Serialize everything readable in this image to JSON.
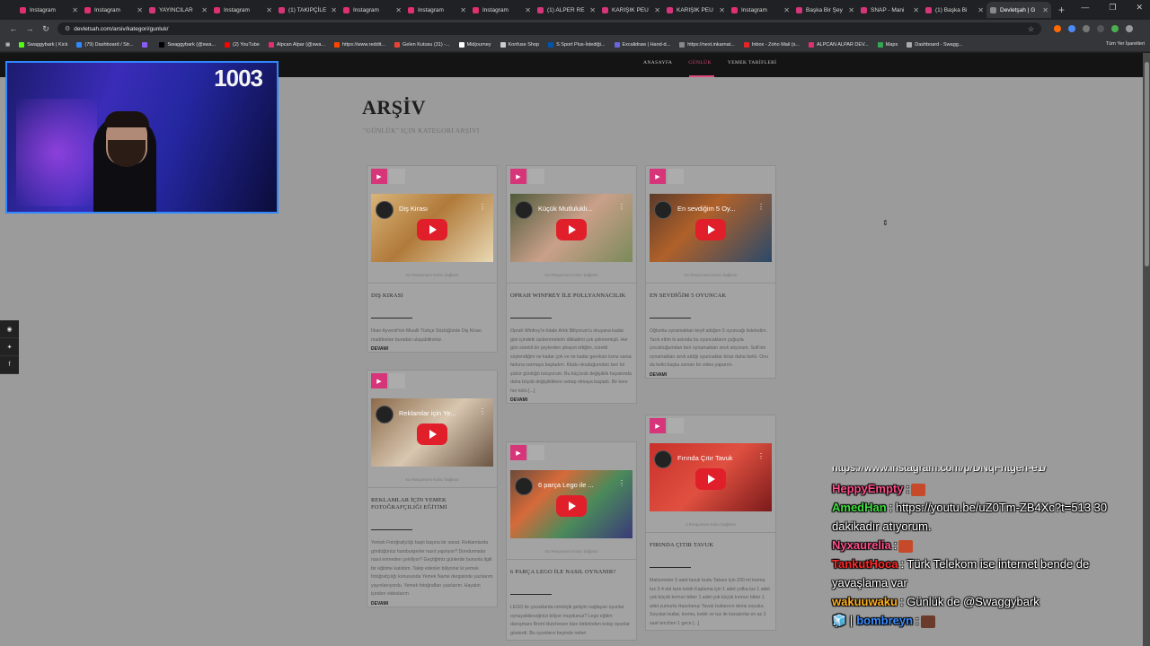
{
  "browser": {
    "tabs": [
      {
        "label": "Instagram",
        "color": "#e1306c"
      },
      {
        "label": "Instagram",
        "color": "#e1306c"
      },
      {
        "label": "YAYINCILAR",
        "color": "#d6357a"
      },
      {
        "label": "Instagram",
        "color": "#e1306c"
      },
      {
        "label": "(1) TAKIPÇİLE",
        "color": "#d6357a"
      },
      {
        "label": "Instagram",
        "color": "#e1306c"
      },
      {
        "label": "Instagram",
        "color": "#e1306c"
      },
      {
        "label": "Instagram",
        "color": "#e1306c"
      },
      {
        "label": "(1) ALPER RE",
        "color": "#d6357a"
      },
      {
        "label": "KARIŞIK PEU",
        "color": "#d6357a"
      },
      {
        "label": "KARIŞIK PEU",
        "color": "#d6357a"
      },
      {
        "label": "Instagram",
        "color": "#e1306c"
      },
      {
        "label": "Başka Bir Şey",
        "color": "#d6357a"
      },
      {
        "label": "SNAP - Mani",
        "color": "#d6357a"
      },
      {
        "label": "(1) Başka Bi",
        "color": "#d6357a"
      },
      {
        "label": "Devletşah | G",
        "color": "#888888",
        "active": true
      }
    ],
    "url": "devletsah.com/arsiv/kategori/gunluk/",
    "bookmarks": [
      {
        "label": "Swaggybark | Kick",
        "color": "#53fc18"
      },
      {
        "label": "(79) Dashboard / Str...",
        "color": "#2d8cff"
      },
      {
        "label": "",
        "color": "#8a5cf6"
      },
      {
        "label": "Swaggybark (@swa...",
        "color": "#000000"
      },
      {
        "label": "(2) YouTube",
        "color": "#ff0000"
      },
      {
        "label": "Alpcan Alpar (@swa...",
        "color": "#e1306c"
      },
      {
        "label": "https://www.reddit...",
        "color": "#ff4500"
      },
      {
        "label": "Gelen Kutusu (31) -...",
        "color": "#ea4335"
      },
      {
        "label": "Midjourney",
        "color": "#ffffff"
      },
      {
        "label": "Konfuse Shop",
        "color": "#cccccc"
      },
      {
        "label": "S Sport Plus-İstediği...",
        "color": "#0055aa"
      },
      {
        "label": "Excalidraw | Hand-d...",
        "color": "#6965db"
      },
      {
        "label": "https://next.inkarnat...",
        "color": "#888888"
      },
      {
        "label": "Inbox - Zoho Mail (s...",
        "color": "#e42527"
      },
      {
        "label": "ALPCAN ALPAR DEV...",
        "color": "#e1306c"
      },
      {
        "label": "Maps",
        "color": "#34a853"
      },
      {
        "label": "Dashboard - Swagg...",
        "color": "#aaaaaa"
      }
    ],
    "bookmarks_all": "Tüm Yer İşaretleri"
  },
  "site": {
    "nav": [
      "ANASAYFA",
      "GÜNLÜK",
      "YEMEK TARİFLERİ"
    ],
    "archive_title": "ARŞİV",
    "archive_sub": "\"GÜNLÜK\" İÇİN KATEGORİ ARŞİVİ",
    "posts": [
      {
        "video_title": "Diş Kirası",
        "meta": "No Responses  Kalıcı bağlantı",
        "title": "DIŞ KIRASI",
        "excerpt": "İlhan Ayverdi'nin Misalli Türkçe Sözlüğünde Diş Kirası maddesine buradan ulaşabilirsiniz.",
        "more": "DEVAMI"
      },
      {
        "video_title": "Reklamlar için Ye...",
        "meta": "No Responses  Kalıcı bağlantı",
        "title": "REKLAMLAR İÇİN YEMEK FOTOĞRAFÇILIĞI EĞİTİMİ",
        "excerpt": "Yemek Fotoğrafçılığı başlı başına bir sanat. Reklamlarda gördüğünüz hamburgerler nasıl yapılıyor? Dondurmalar nasıl erimeden çekiliyor? Geçtiğimiz günlerde bununla ilgili bir eğitime katıldım. Takip edenler biliyorlar ki yemek fotoğrafçılığı konusunda Yemek Name dergisinde yazılarım yayınlanıyordu. Yemek fotoğrafları yazılarım. Hayatın içinden videolarım",
        "more": "DEVAMI"
      },
      {
        "video_title": "Küçük Mutluluklı...",
        "meta": "No Responses  Kalıcı bağlantı",
        "title": "OPRAH WINFREY İLE POLLYANNACILIK",
        "excerpt": "Oprah Winfrey'in kitabı Artık Biliyorum'u okuyana kadar gün içindeki üzülenmelerin dikkatimi çok çekmemişti. Her gün sürekli bir şeylerden şikayet ettiğim, sürekli söylendiğim ne kadar çok ve ne kadar gereksiz konu varsa farkına varmaya başladım. Kitabı okuduğumdan beri bir şükür günlüğü tutuyorum. Bu küçücük değişiklik hayatımda daha büyük değişikliklere sebep olmaya başladı. Bir kere her kötü [...]",
        "more": "DEVAMI"
      },
      {
        "video_title": "6 parça Lego ile ...",
        "meta": "No Responses  Kalıcı bağlantı",
        "title": "6 PARÇA LEGO İLE NASIL OYNANIR?",
        "excerpt": "LEGO ile çocuklarda nörolojik gelişim sağlayan oyunlar oynayabileceğinizi biliyor muydunuz? Lego eğitim danışmanı Brent Hutcheson bize birbirinden kolay oyunlar gösterdi. Bu oyunların beyinde neleri",
        "more": ""
      },
      {
        "video_title": "En sevdiğim 5 Oy...",
        "meta": "No Responses  Kalıcı bağlantı",
        "title": "EN SEVDİĞİM 5 OYUNCAK",
        "excerpt": "Oğlumla oynamaktan keyif aldığım 5 oyuncağı listeledim. Tarık ettim ki aslında bu oyuncakların çoğuyla çocukluğumdan beri oynamaktan zevk alıyorum. Sufi'nin oynamaktan zevk aldığı oyuncaklar biraz daha farklı. Onu da belki başka zaman bir video yaparım.",
        "more": "DEVAMI"
      },
      {
        "video_title": "Fırında Çıtır Tavuk",
        "meta": "3 Responses  Kalıcı bağlantı",
        "title": "FIRINDA ÇITIR TAVUK",
        "excerpt": "Malzemeler 5 adet tavuk budu Tabanı için 200 ml krema tuz 3-4 dal taze kekik Kaplama için 1 adet yufka tuz 1 adet çok küçük kırmızı biber 1 adet çok küçük kırmızı biber 1 adet yumurta Hazırlanışı Tavuk butlarının derisi soyulur. Soyulan butlar, krema, kekik ve tuz ile karıştırılıp en az 2 saat tercihen 1 gece [...]",
        "more": ""
      }
    ],
    "social_icons": [
      "rss-icon",
      "twitter-icon",
      "facebook-icon"
    ]
  },
  "stream": {
    "viewer_count": "1003",
    "chat": [
      {
        "user": "",
        "user_color": "#ffffff",
        "text": "https://www.instagram.com/p/DNqFhtgeri-e1/",
        "cut": true
      },
      {
        "user": "HeppyEmpty",
        "user_color": "#ff4f8b",
        "text": ":",
        "emote": "#c64a2a"
      },
      {
        "user": "AmedHan",
        "user_color": "#3fe03f",
        "text": ": https://youtu.be/uZ0Tm-ZB4Xc?t=513 30 dakikadır atıyorum."
      },
      {
        "user": "Nyxaurelia",
        "user_color": "#ff4f8b",
        "text": ":",
        "emote": "#c64a2a"
      },
      {
        "user": "TankutHoca",
        "user_color": "#ff2a2a",
        "text": ": Türk Telekom ise internet bende de yavaşlama var"
      },
      {
        "user": "wakuuwaku",
        "user_color": "#ffb020",
        "text": ": Günlük de @Swaggybark"
      },
      {
        "user": "bombreyn",
        "user_color": "#3a8bff",
        "text": ":",
        "emote": "#6a3a2a",
        "badge": "🧊 |"
      }
    ]
  }
}
